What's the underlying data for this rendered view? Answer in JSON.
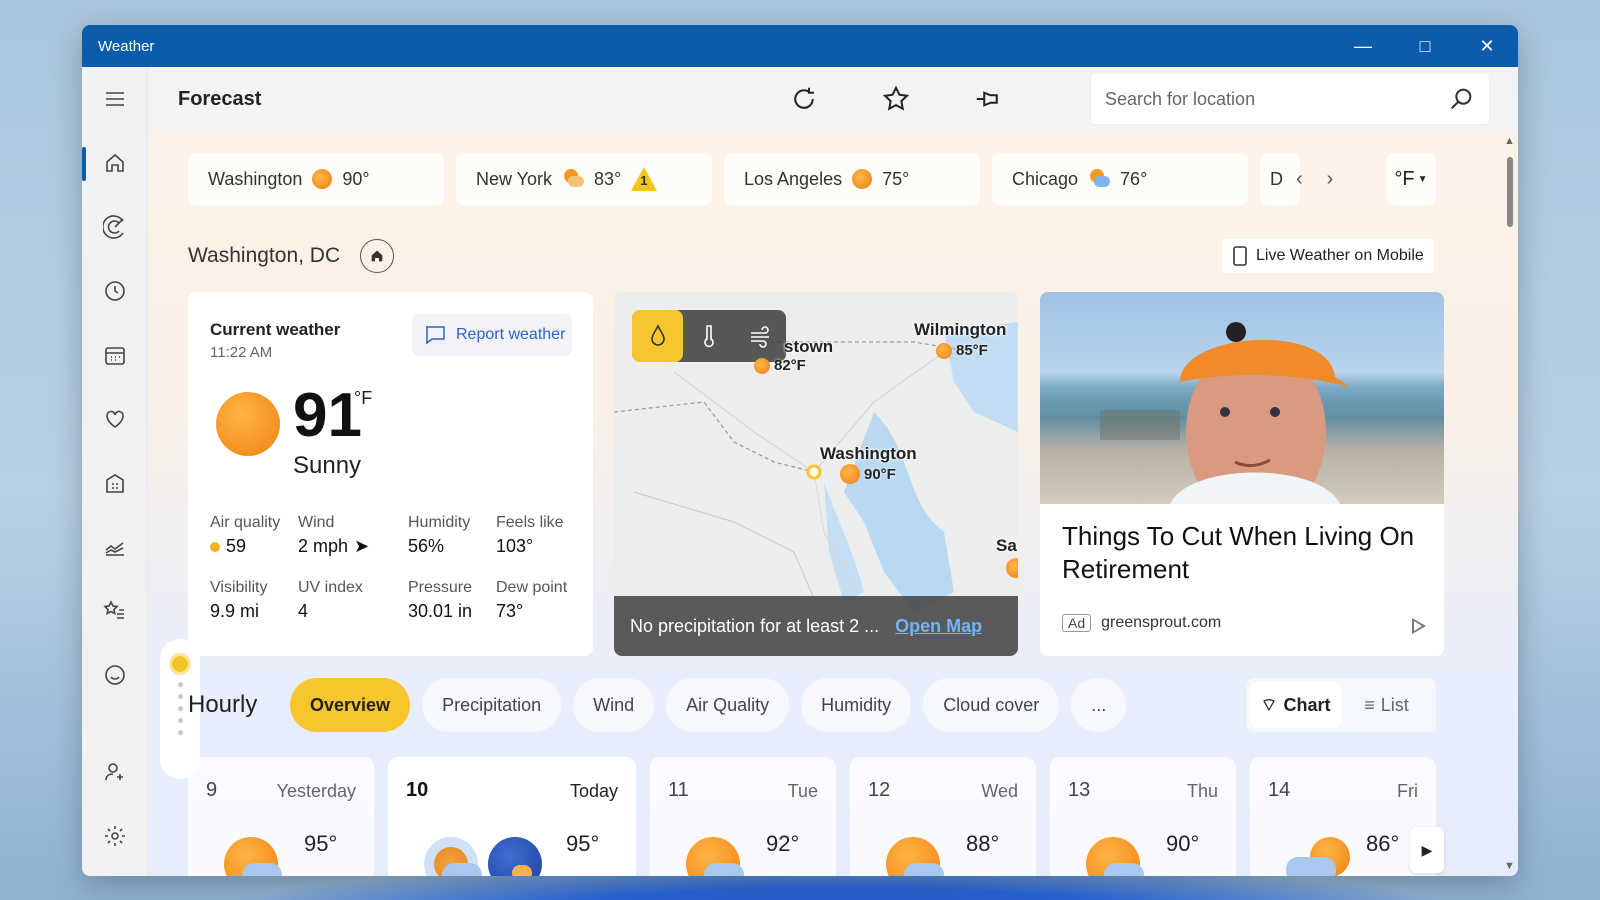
{
  "window": {
    "title": "Weather"
  },
  "header": {
    "title": "Forecast",
    "search_placeholder": "Search for location"
  },
  "cities": [
    {
      "name": "Washington",
      "temp": "90°"
    },
    {
      "name": "New York",
      "temp": "83°",
      "alert_count": "1"
    },
    {
      "name": "Los Angeles",
      "temp": "75°"
    },
    {
      "name": "Chicago",
      "temp": "76°"
    },
    {
      "name": "D"
    }
  ],
  "unit": "°F",
  "location": {
    "name": "Washington, DC",
    "mobile_button": "Live Weather on Mobile"
  },
  "current": {
    "heading": "Current weather",
    "time": "11:22 AM",
    "report_label": "Report weather",
    "temp": "91",
    "unit": "°F",
    "condition": "Sunny",
    "metrics": [
      {
        "label": "Air quality",
        "value": "59"
      },
      {
        "label": "Wind",
        "value": "2 mph"
      },
      {
        "label": "Humidity",
        "value": "56%"
      },
      {
        "label": "Feels like",
        "value": "103°"
      },
      {
        "label": "Visibility",
        "value": "9.9 mi"
      },
      {
        "label": "UV index",
        "value": "4"
      },
      {
        "label": "Pressure",
        "value": "30.01 in"
      },
      {
        "label": "Dew point",
        "value": "73°"
      }
    ]
  },
  "map": {
    "places": [
      {
        "name": "stown",
        "temp": "82°F"
      },
      {
        "name": "Wilmington",
        "temp": "85°F"
      },
      {
        "name": "Washington",
        "temp": "90°F"
      },
      {
        "name": "Sa"
      }
    ],
    "footer_text": "No precipitation for at least 2 ...",
    "open_map": "Open Map"
  },
  "ad": {
    "title": "Things To Cut When Living On Retirement",
    "tag": "Ad",
    "source": "greensprout.com"
  },
  "hourly": {
    "title": "Hourly",
    "tabs": [
      "Overview",
      "Precipitation",
      "Wind",
      "Air Quality",
      "Humidity",
      "Cloud cover",
      "..."
    ],
    "view_chart": "Chart",
    "view_list": "List"
  },
  "days": [
    {
      "num": "9",
      "name": "Yesterday",
      "temp": "95°"
    },
    {
      "num": "10",
      "name": "Today",
      "temp": "95°"
    },
    {
      "num": "11",
      "name": "Tue",
      "temp": "92°"
    },
    {
      "num": "12",
      "name": "Wed",
      "temp": "88°"
    },
    {
      "num": "13",
      "name": "Thu",
      "temp": "90°"
    },
    {
      "num": "14",
      "name": "Fri",
      "temp": "86°"
    }
  ],
  "colors": {
    "accent": "#0b5cad",
    "highlight": "#f7c62f",
    "link": "#2d63c4"
  }
}
